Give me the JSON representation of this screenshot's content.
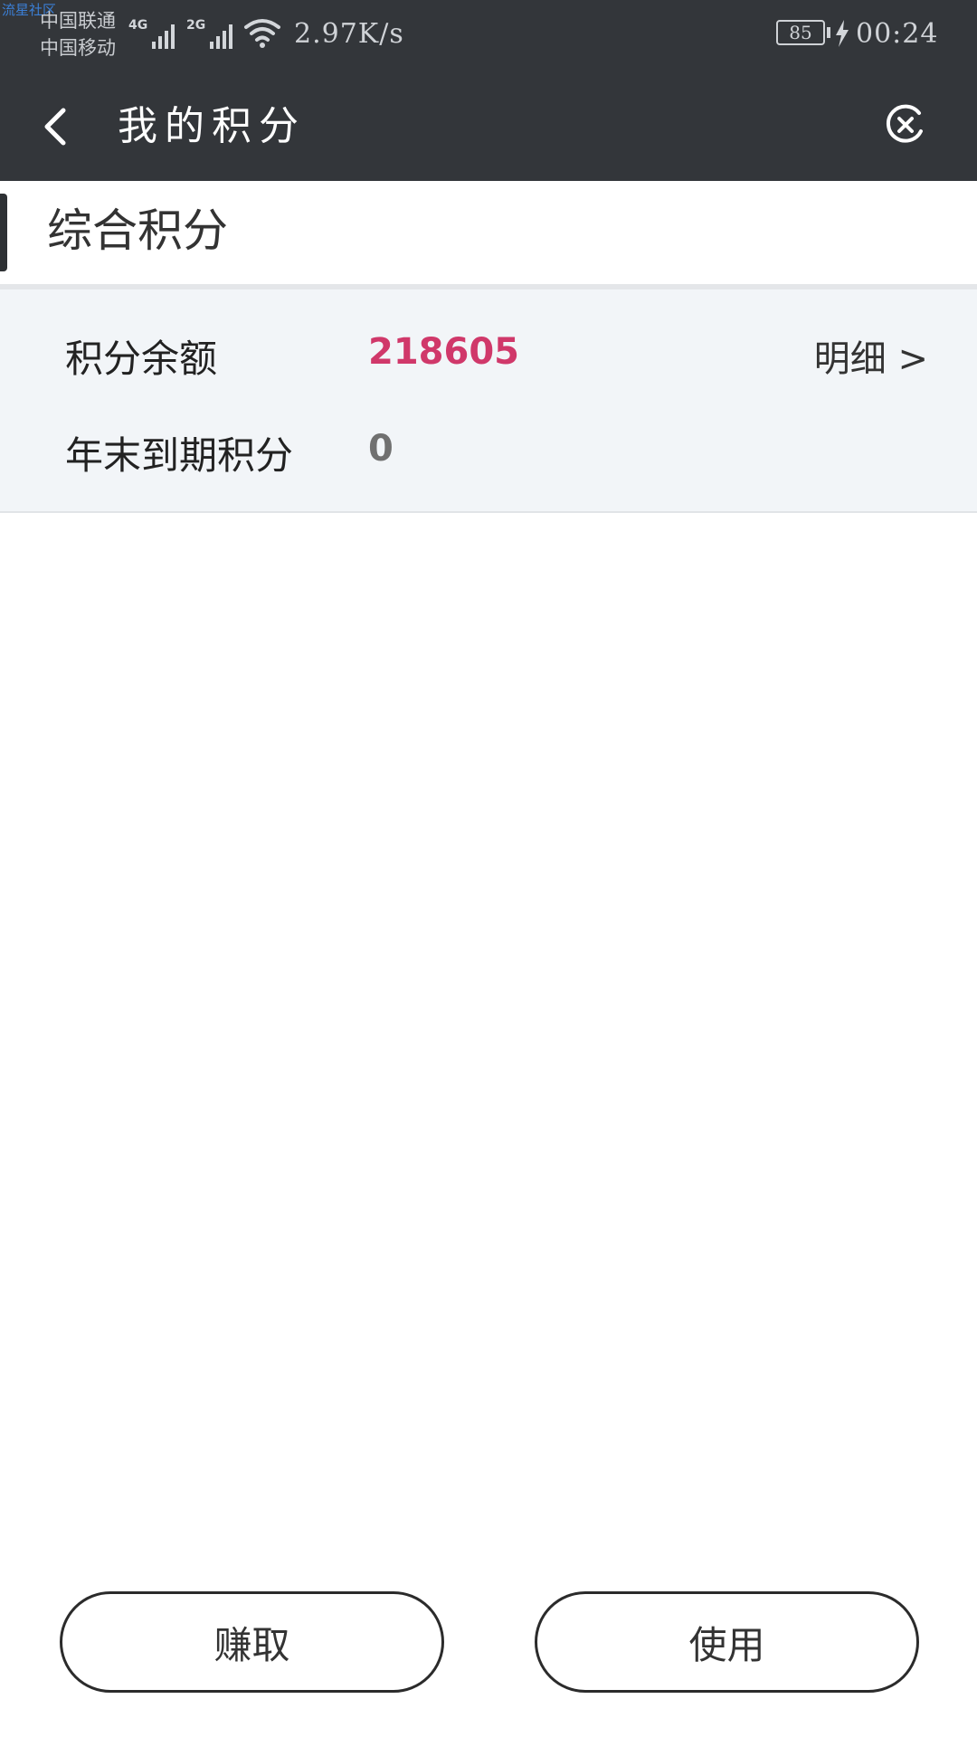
{
  "status_bar": {
    "watermark": "流星社区",
    "carrier_1": "中国联通",
    "carrier_2": "中国移动",
    "signal_1_type": "4G",
    "signal_2_type": "2G",
    "net_speed": "2.97K/s",
    "battery_level": "85",
    "time": "00:24"
  },
  "header": {
    "back_icon": "chevron-left-icon",
    "title": "我的积分",
    "close_icon": "circle-x-icon"
  },
  "section": {
    "title": "综合积分"
  },
  "points": {
    "balance_label": "积分余额",
    "balance_value": "218605",
    "detail_link": "明细 >",
    "expiring_label": "年末到期积分",
    "expiring_value": "0"
  },
  "actions": {
    "earn_label": "赚取",
    "use_label": "使用"
  },
  "colors": {
    "header_bg": "#33363a",
    "balance_accent": "#d0386a",
    "panel_bg": "#f2f5f8"
  }
}
